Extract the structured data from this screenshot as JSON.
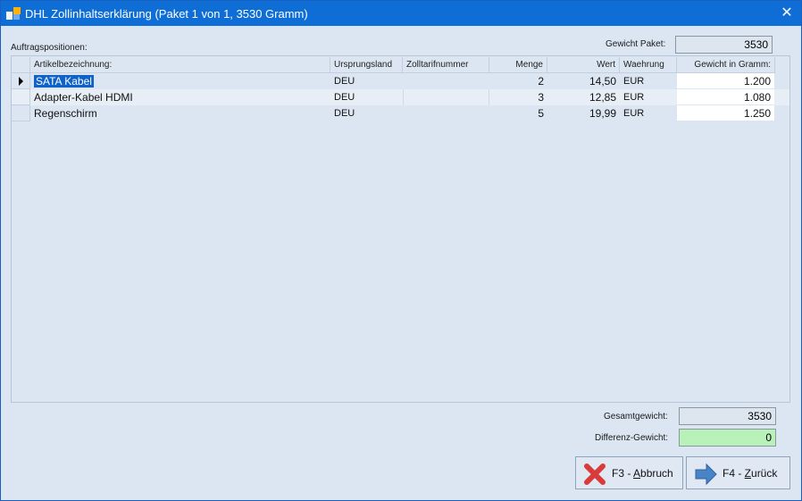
{
  "window": {
    "title": "DHL Zollinhaltserklärung (Paket 1 von 1, 3530 Gramm)",
    "close_glyph": "✕"
  },
  "labels": {
    "positions": "Auftragspositionen:",
    "package_weight": "Gewicht Paket:",
    "total_weight": "Gesamtgewicht:",
    "diff_weight": "Differenz-Gewicht:"
  },
  "fields": {
    "package_weight": "3530",
    "total_weight": "3530",
    "diff_weight": "0"
  },
  "table": {
    "columns": [
      "Artikelbezeichnung:",
      "Ursprungsland",
      "Zolltarifnummer",
      "Menge",
      "Wert",
      "Waehrung",
      "Gewicht in Gramm:"
    ],
    "rows": [
      {
        "name": "SATA Kabel",
        "country": "DEU",
        "tariff": "",
        "qty": "2",
        "value": "14,50",
        "currency": "EUR",
        "weight": "1.200"
      },
      {
        "name": "Adapter-Kabel HDMI",
        "country": "DEU",
        "tariff": "",
        "qty": "3",
        "value": "12,85",
        "currency": "EUR",
        "weight": "1.080"
      },
      {
        "name": "Regenschirm",
        "country": "DEU",
        "tariff": "",
        "qty": "5",
        "value": "19,99",
        "currency": "EUR",
        "weight": "1.250"
      }
    ],
    "selected_row": 0
  },
  "buttons": {
    "cancel": {
      "prefix": "F3 - ",
      "mnemonic": "A",
      "rest": "bbruch"
    },
    "back": {
      "prefix": "F4 - ",
      "mnemonic": "Z",
      "rest": "urück"
    }
  },
  "colors": {
    "titlebar": "#0f6ed6",
    "selection": "#0f63c8",
    "diff_ok": "#b9f2b9",
    "cancel_icon": "#d93a3a",
    "arrow_icon": "#4a84c8"
  }
}
